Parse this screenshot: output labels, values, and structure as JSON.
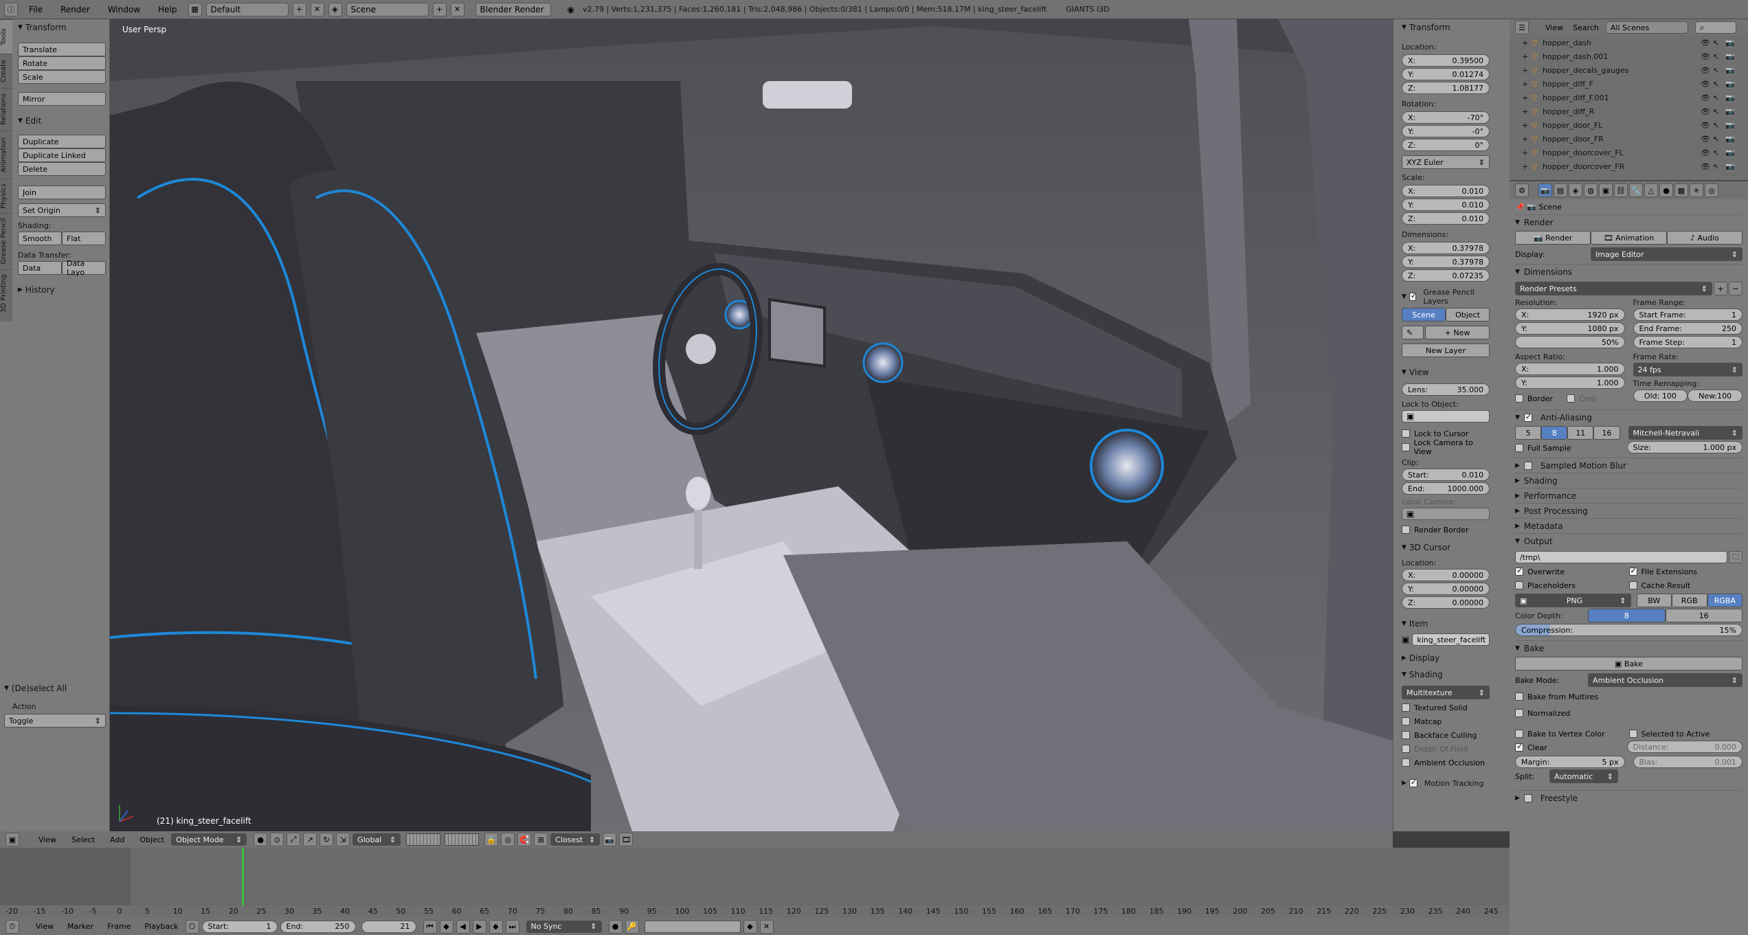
{
  "topbar": {
    "menus": [
      "File",
      "Render",
      "Window",
      "Help"
    ],
    "layout": "Default",
    "scene": "Scene",
    "engine": "Blender Render",
    "stats": "v2.79 | Verts:1,231,375 | Faces:1,260,181 | Tris:2,048,986 | Objects:0/381 | Lamps:0/0 | Mem:518.17M | king_steer_facelift",
    "brand": "GIANTS I3D"
  },
  "tabs": [
    "Tools",
    "Create",
    "Relations",
    "Animation",
    "Physics",
    "Grease Pencil",
    "3D Printing"
  ],
  "toolshelf": {
    "transform_title": "Transform",
    "translate": "Translate",
    "rotate": "Rotate",
    "scale": "Scale",
    "mirror": "Mirror",
    "edit_title": "Edit",
    "duplicate": "Duplicate",
    "duplicate_linked": "Duplicate Linked",
    "delete": "Delete",
    "join": "Join",
    "set_origin": "Set Origin",
    "shading_label": "Shading:",
    "smooth": "Smooth",
    "flat": "Flat",
    "data_transfer_label": "Data Transfer:",
    "data": "Data",
    "data_layo": "Data Layo",
    "history_title": "History",
    "op_title": "(De)select All",
    "action_label": "Action",
    "action_value": "Toggle"
  },
  "viewport": {
    "persp_label": "User Persp",
    "object_label": "(21) king_steer_facelift",
    "accent": "#1e88d8"
  },
  "npanel": {
    "transform_title": "Transform",
    "location_label": "Location:",
    "loc_x": "0.39500",
    "loc_y": "0.01274",
    "loc_z": "1.08177",
    "rotation_label": "Rotation:",
    "rot_x": "-70°",
    "rot_y": "-0°",
    "rot_z": "0°",
    "rot_mode": "XYZ Euler",
    "scale_label": "Scale:",
    "sc_x": "0.010",
    "sc_y": "0.010",
    "sc_z": "0.010",
    "dims_label": "Dimensions:",
    "dim_x": "0.37978",
    "dim_y": "0.37978",
    "dim_z": "0.07235",
    "gp_title": "Grease Pencil Layers",
    "gp_scene": "Scene",
    "gp_object": "Object",
    "gp_new": "New",
    "gp_new_layer": "New Layer",
    "view_title": "View",
    "lens_label": "Lens:",
    "lens_value": "35.000",
    "lock_obj_label": "Lock to Object:",
    "lock_cursor": "Lock to Cursor",
    "lock_camera": "Lock Camera to View",
    "clip_label": "Clip:",
    "clip_start_label": "Start:",
    "clip_start": "0.010",
    "clip_end_label": "End:",
    "clip_end": "1000.000",
    "local_camera": "Local Camera:",
    "render_border": "Render Border",
    "cursor_title": "3D Cursor",
    "cursor_loc_label": "Location:",
    "cur_x": "0.00000",
    "cur_y": "0.00000",
    "cur_z": "0.00000",
    "item_title": "Item",
    "item_name": "king_steer_facelift",
    "display_title": "Display",
    "shading_title": "Shading",
    "shading_mode": "Multitexture",
    "textured_solid": "Textured Solid",
    "matcap": "Matcap",
    "backface": "Backface Culling",
    "depth_of_field": "Depth Of Field",
    "ambient_occ": "Ambient Occlusion",
    "motion_tracking": "Motion Tracking"
  },
  "outliner": {
    "view": "View",
    "search": "Search",
    "scenes": "All Scenes",
    "items": [
      "hopper_dash",
      "hopper_dash.001",
      "hopper_decals_gauges",
      "hopper_diff_F",
      "hopper_diff_F.001",
      "hopper_diff_R",
      "hopper_door_FL",
      "hopper_door_FR",
      "hopper_doorcover_FL",
      "hopper_doorcover_FR"
    ]
  },
  "props": {
    "scene": "Scene",
    "render_title": "Render",
    "render_btn": "Render",
    "animation_btn": "Animation",
    "audio_btn": "Audio",
    "display_label": "Display:",
    "display_value": "Image Editor",
    "dims_title": "Dimensions",
    "presets": "Render Presets",
    "resolution": "Resolution:",
    "res_x": "1920 px",
    "res_y": "1080 px",
    "res_pct": "50%",
    "frame_range": "Frame Range:",
    "start_frame_label": "Start Frame:",
    "start_frame": "1",
    "end_frame_label": "End Frame:",
    "end_frame": "250",
    "frame_step_label": "Frame Step:",
    "frame_step": "1",
    "aspect": "Aspect Ratio:",
    "asp_x": "1.000",
    "asp_y": "1.000",
    "frame_rate": "Frame Rate:",
    "fps": "24 fps",
    "time_remap": "Time Remapping:",
    "old": "Old: 100",
    "new": "New:100",
    "border": "Border",
    "crop": "Crop",
    "aa_title": "Anti-Aliasing",
    "aa_samples": [
      "5",
      "8",
      "11",
      "16"
    ],
    "aa_filter": "Mitchell-Netravali",
    "full_sample": "Full Sample",
    "aa_size_label": "Size:",
    "aa_size": "1.000 px",
    "collapsed": [
      "Sampled Motion Blur",
      "Shading",
      "Performance",
      "Post Processing",
      "Metadata"
    ],
    "output_title": "Output",
    "output_path": "/tmp\\",
    "overwrite": "Overwrite",
    "file_ext": "File Extensions",
    "placeholders": "Placeholders",
    "cache_result": "Cache Result",
    "format": "PNG",
    "bw": "BW",
    "rgb": "RGB",
    "rgba": "RGBA",
    "color_depth": "Color Depth:",
    "depth8": "8",
    "depth16": "16",
    "compression_label": "Compression:",
    "compression": "15%",
    "bake_title": "Bake",
    "bake_btn": "Bake",
    "bake_mode_label": "Bake Mode:",
    "bake_mode": "Ambient Occlusion",
    "bake_multires": "Bake from Multires",
    "normalized": "Normalized",
    "bake_vertex": "Bake to Vertex Color",
    "selected_active": "Selected to Active",
    "clear": "Clear",
    "distance_label": "Distance:",
    "distance": "0.000",
    "margin_label": "Margin:",
    "margin": "5 px",
    "bias_label": "Bias:",
    "bias": "0.001",
    "split_label": "Split:",
    "split": "Automatic",
    "freestyle": "Freestyle"
  },
  "viewheader": {
    "view": "View",
    "select": "Select",
    "add": "Add",
    "object": "Object",
    "mode": "Object Mode",
    "orientation": "Global",
    "snap": "Closest"
  },
  "timeline": {
    "ticks": [
      "-20",
      "-15",
      "-10",
      "-5",
      "0",
      "5",
      "10",
      "15",
      "20",
      "25",
      "30",
      "35",
      "40",
      "45",
      "50",
      "55",
      "60",
      "65",
      "70",
      "75",
      "80",
      "85",
      "90",
      "95",
      "100",
      "105",
      "110",
      "115",
      "120",
      "125",
      "130",
      "135",
      "140",
      "145",
      "150",
      "155",
      "160",
      "165",
      "170",
      "175",
      "180",
      "185",
      "190",
      "195",
      "200",
      "205",
      "210",
      "215",
      "220",
      "225",
      "230",
      "235",
      "240",
      "245"
    ],
    "view": "View",
    "marker": "Marker",
    "frame": "Frame",
    "playback": "Playback",
    "start_label": "Start:",
    "start": "1",
    "end_label": "End:",
    "end": "250",
    "current": "21",
    "sync": "No Sync"
  }
}
